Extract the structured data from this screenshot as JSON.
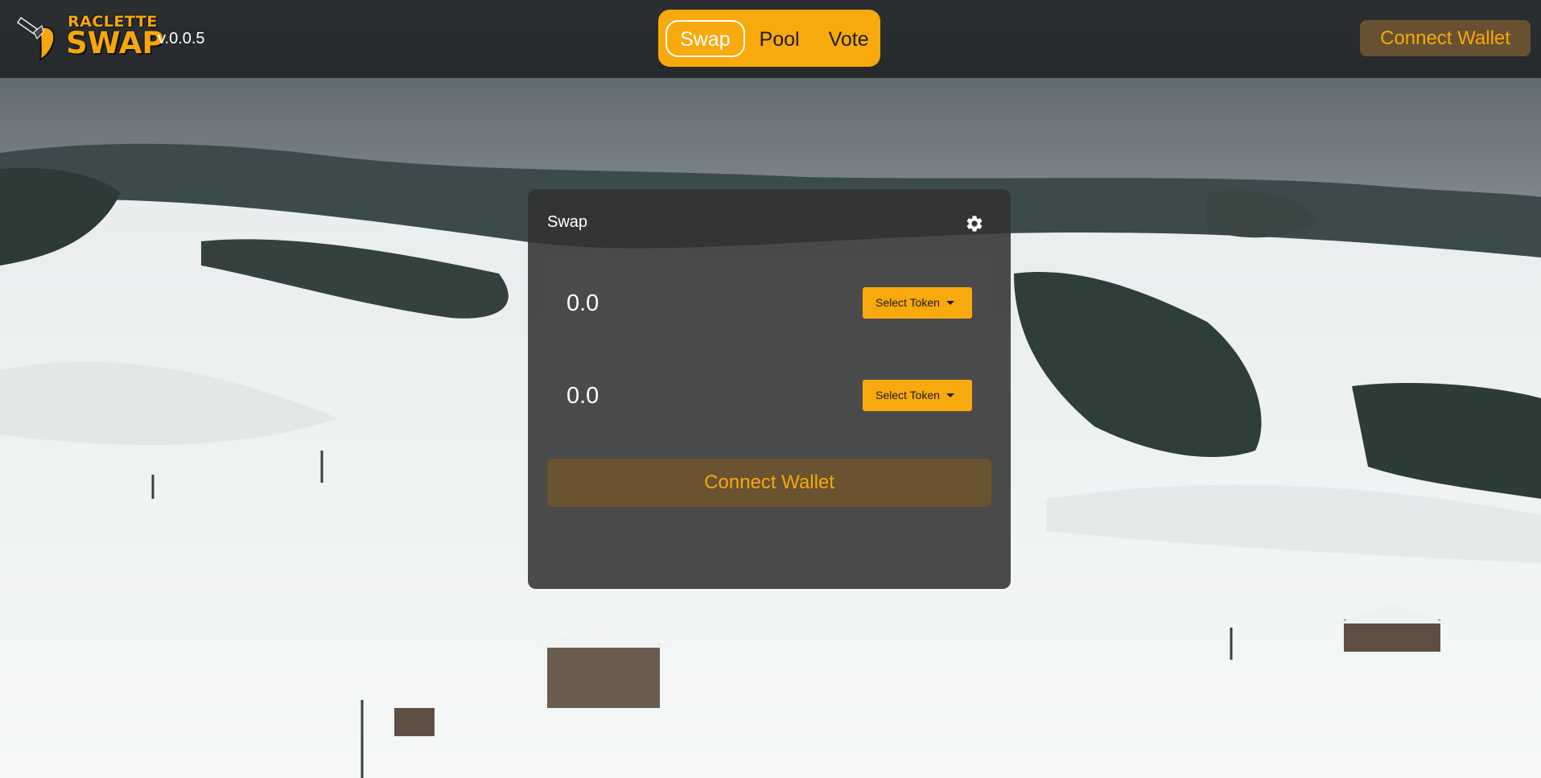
{
  "header": {
    "logo_top": "RACLETTE",
    "logo_bottom": "SWAP",
    "version": "v.0.0.5",
    "nav": [
      "Swap",
      "Pool",
      "Vote"
    ],
    "active_nav": "Swap",
    "connect_wallet": "Connect Wallet"
  },
  "swap": {
    "title": "Swap",
    "settings_icon": "gear-icon",
    "input_from": {
      "placeholder": "0.0",
      "select_label": "Select Token"
    },
    "input_to": {
      "placeholder": "0.0",
      "select_label": "Select Token"
    },
    "connect_wallet": "Connect Wallet"
  },
  "colors": {
    "accent": "#f7a90e",
    "header_bg": "#282c2e",
    "card_bg": "#323232",
    "row_bg": "#4a4a4a",
    "wallet_btn_bg": "#685130"
  }
}
